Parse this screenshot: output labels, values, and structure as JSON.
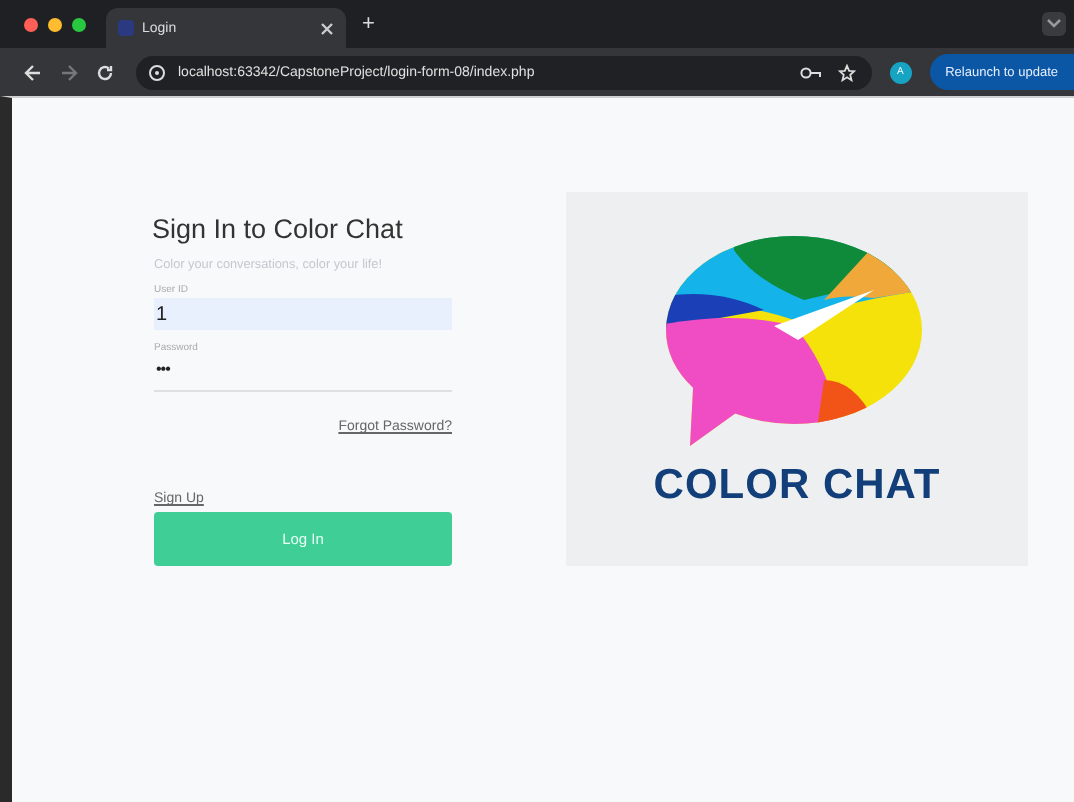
{
  "browser": {
    "tab": {
      "title": "Login",
      "selected": true
    },
    "new_tab": "+",
    "address": "localhost:63342/CapstoneProject/login-form-08/index.php",
    "profile": "A",
    "relaunch": "Relaunch to update"
  },
  "form": {
    "title": "Sign In to Color Chat",
    "subtitle": "Color your conversations, color your life!",
    "fields": [
      {
        "label": "User ID",
        "value": "1",
        "kind": "text",
        "autofilled": true
      },
      {
        "label": "Password",
        "value": "•••",
        "kind": "password",
        "autofilled": false
      }
    ],
    "forgot": "Forgot Password?",
    "signup": "Sign Up",
    "submit": "Log In"
  },
  "logo": {
    "text": "COLOR CHAT"
  }
}
